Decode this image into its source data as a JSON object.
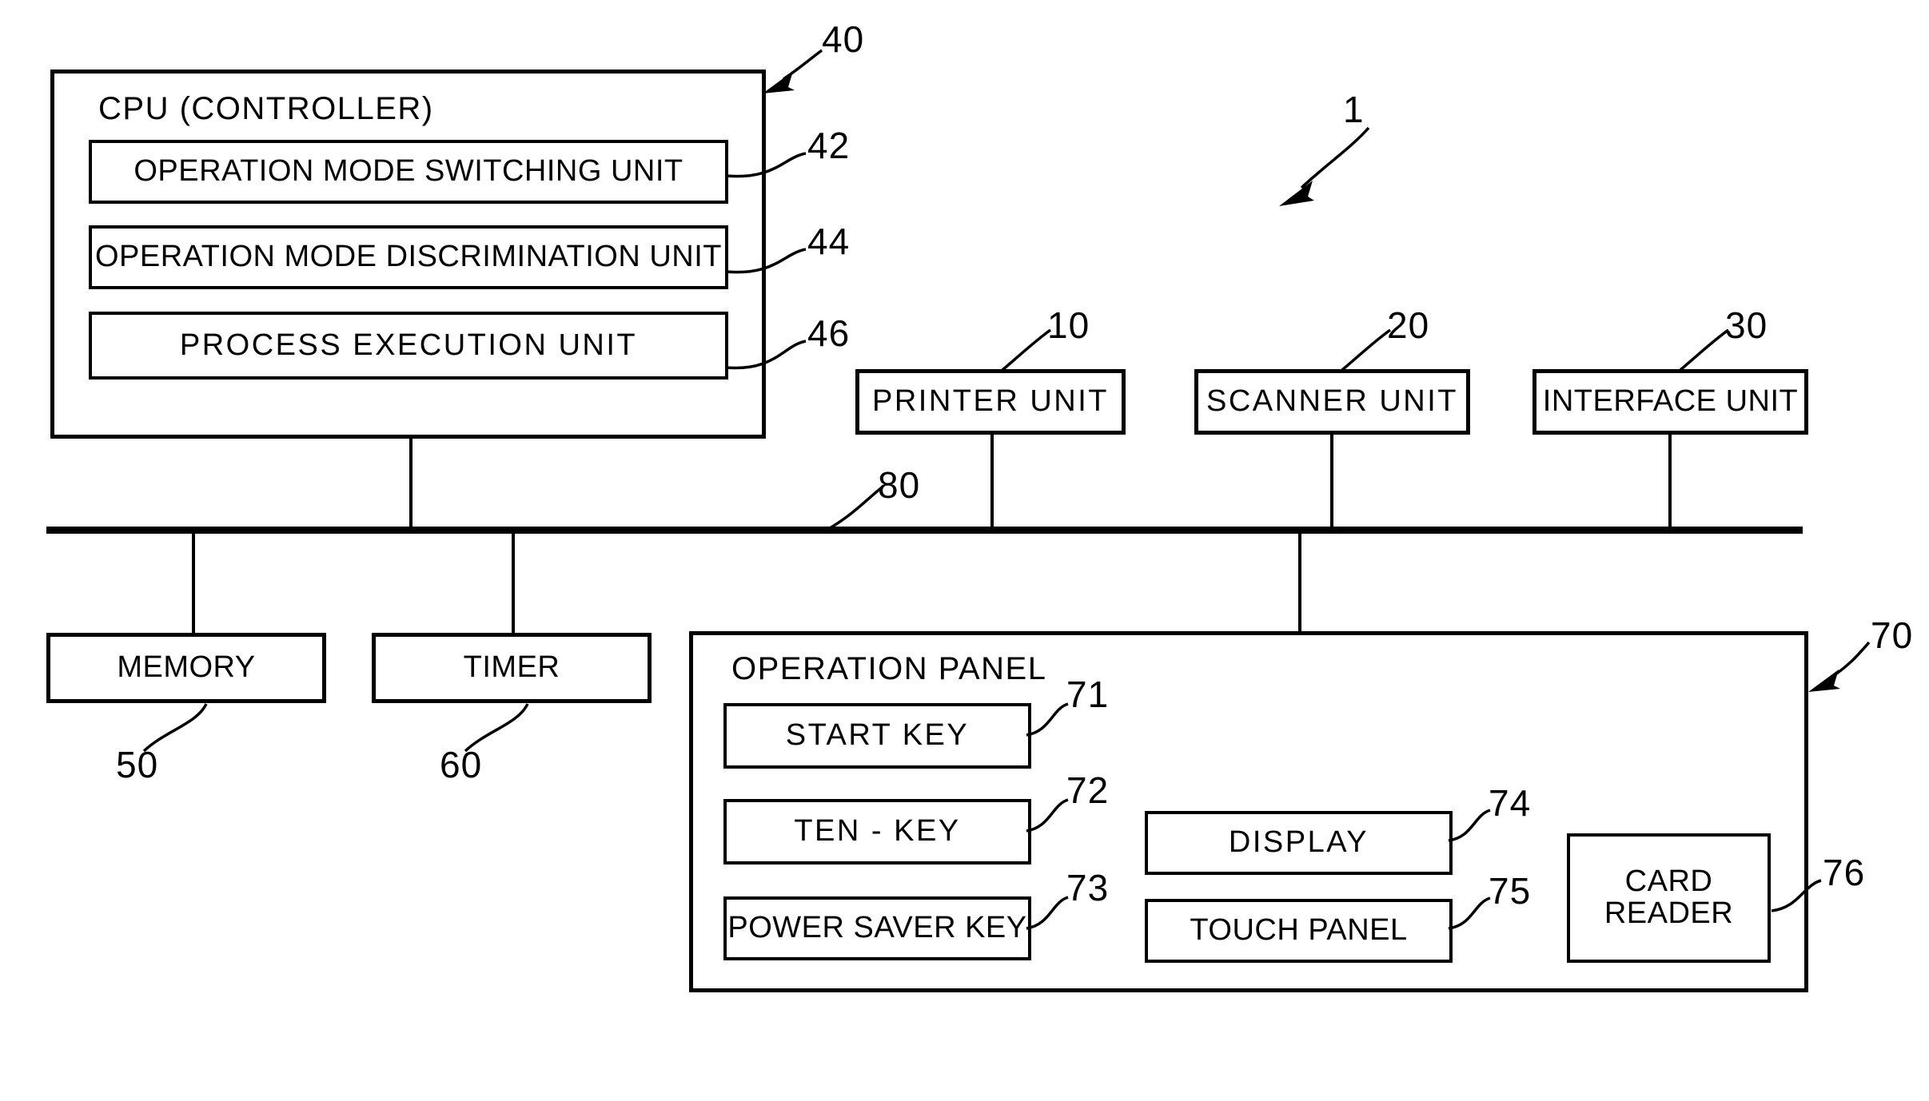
{
  "figure": {
    "system_ref": "1",
    "bus_ref": "80"
  },
  "cpu": {
    "title": "CPU (CONTROLLER)",
    "ref": "40",
    "units": [
      {
        "label": "OPERATION MODE SWITCHING UNIT",
        "ref": "42"
      },
      {
        "label": "OPERATION MODE DISCRIMINATION UNIT",
        "ref": "44"
      },
      {
        "label": "PROCESS  EXECUTION  UNIT",
        "ref": "46"
      }
    ]
  },
  "top_units": [
    {
      "label": "PRINTER  UNIT",
      "ref": "10"
    },
    {
      "label": "SCANNER  UNIT",
      "ref": "20"
    },
    {
      "label": "INTERFACE UNIT",
      "ref": "30"
    }
  ],
  "bottom_units": [
    {
      "label": "MEMORY",
      "ref": "50"
    },
    {
      "label": "TIMER",
      "ref": "60"
    }
  ],
  "operation_panel": {
    "title": "OPERATION PANEL",
    "ref": "70",
    "components": [
      {
        "label": "START KEY",
        "ref": "71"
      },
      {
        "label": "TEN - KEY",
        "ref": "72"
      },
      {
        "label": "POWER SAVER KEY",
        "ref": "73"
      },
      {
        "label": "DISPLAY",
        "ref": "74"
      },
      {
        "label": "TOUCH PANEL",
        "ref": "75"
      },
      {
        "label": "CARD\nREADER",
        "ref": "76"
      }
    ]
  }
}
